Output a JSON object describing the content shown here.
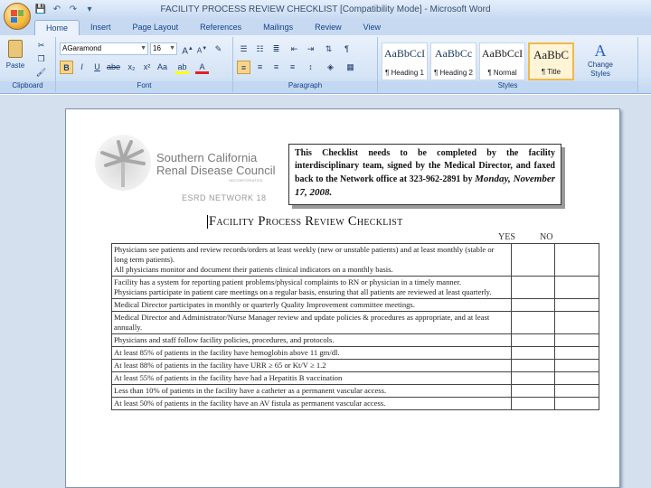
{
  "window": {
    "title": "FACILITY PROCESS REVIEW CHECKLIST [Compatibility Mode] - Microsoft Word"
  },
  "quick_access": [
    {
      "icon": "save-icon",
      "glyph": "💾"
    },
    {
      "icon": "undo-icon",
      "glyph": "↶"
    },
    {
      "icon": "redo-icon",
      "glyph": "↷"
    },
    {
      "icon": "customize-icon",
      "glyph": "▾"
    }
  ],
  "tabs": [
    "Home",
    "Insert",
    "Page Layout",
    "References",
    "Mailings",
    "Review",
    "View"
  ],
  "ribbon": {
    "clipboard": {
      "paste_label": "Paste",
      "group_label": "Clipboard"
    },
    "font": {
      "font_name": "AGaramond",
      "font_size": "16",
      "group_label": "Font"
    },
    "paragraph": {
      "group_label": "Paragraph"
    },
    "styles": {
      "group_label": "Styles",
      "items": [
        {
          "sample": "AaBbCcI",
          "name": "¶ Heading 1"
        },
        {
          "sample": "AaBbCc",
          "name": "¶ Heading 2"
        },
        {
          "sample": "AaBbCcI",
          "name": "¶ Normal"
        },
        {
          "sample": "AaBbC",
          "name": "¶ Title"
        }
      ],
      "change_styles_label": "Change Styles"
    }
  },
  "document": {
    "logo": {
      "line1": "Southern California",
      "line2": "Renal Disease Council",
      "tagline": "INCORPORATED"
    },
    "esrd": "ESRD NETWORK 18",
    "callout": {
      "text": "This Checklist needs to be completed by the facility interdisciplinary team, signed by the Medical Director, and faxed back to the Network office at 323-962-2891 by",
      "date": "Monday,   November 17, 2008."
    },
    "checklist_title": "Facility Process Review Checklist",
    "columns": {
      "yes": "YES",
      "no": "NO"
    },
    "rows": [
      {
        "lines": [
          "Physicians see patients and review records/orders at least weekly (new or unstable patients) and at least monthly (stable or long term patients).",
          "All physicians monitor and document their patients clinical indicators on a monthly basis."
        ]
      },
      {
        "lines": [
          "Facility has a system for reporting patient problems/physical complaints to RN or physician in a timely manner.",
          "Physicians participate in patient care meetings on a regular basis, ensuring that all patients are reviewed at least quarterly."
        ]
      },
      {
        "lines": [
          "Medical Director participates in monthly or quarterly Quality Improvement committee meetings."
        ]
      },
      {
        "lines": [
          "Medical Director and Administrator/Nurse Manager review and update policies & procedures as appropriate, and at least annually."
        ]
      },
      {
        "lines": [
          "Physicians and staff follow facility policies, procedures, and protocols."
        ]
      },
      {
        "lines": [
          "At least 85% of patients in the facility have hemoglobin above 11 gm/dl."
        ]
      },
      {
        "lines": [
          "At least 88% of patients in the facility have URR ≥ 65 or Kt/V ≥ 1.2"
        ]
      },
      {
        "lines": [
          "At least 55% of patients in the facility have had a Hepatitis B vaccination"
        ]
      },
      {
        "lines": [
          "Less than 10% of patients in the facility have a catheter as a permanent vascular access."
        ]
      },
      {
        "lines": [
          "At least 50% of patients in the facility have an AV fistula as permanent vascular access."
        ]
      }
    ]
  },
  "colors": {
    "ribbon_bg": "#d5e4f6",
    "tab_text": "#15428b",
    "selected_style": "#f0b94a"
  }
}
